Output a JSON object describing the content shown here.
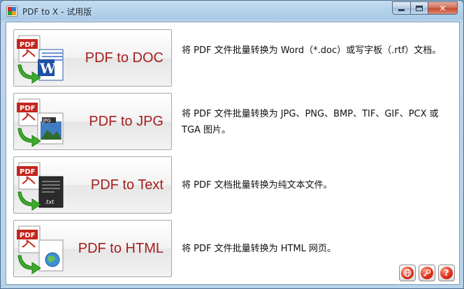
{
  "window": {
    "title": "PDF to X - 试用版"
  },
  "converters": [
    {
      "label": "PDF to DOC",
      "description": "将 PDF 文件批量转换为 Word（*.doc）或写字板（.rtf）文档。",
      "icon": "pdf-to-word-icon",
      "doc_badge_text": "PDF",
      "target_text": "W"
    },
    {
      "label": "PDF to JPG",
      "description": "将 PDF 文件批量转换为 JPG、PNG、BMP、TIF、GIF、PCX 或 TGA 图片。",
      "icon": "pdf-to-image-icon",
      "doc_badge_text": "PDF",
      "target_text": "JPG"
    },
    {
      "label": "PDF to Text",
      "description": "将 PDF 文档批量转换为纯文本文件。",
      "icon": "pdf-to-text-icon",
      "doc_badge_text": "PDF",
      "target_text": ".txt"
    },
    {
      "label": "PDF to HTML",
      "description": "将 PDF 文件批量转换为 HTML 网页。",
      "icon": "pdf-to-html-icon",
      "doc_badge_text": "PDF",
      "target_text": ""
    }
  ],
  "toolbar": {
    "web_icon": "globe-icon",
    "register_icon": "key-icon",
    "help_label": "?"
  },
  "colors": {
    "label_red": "#a51d1d",
    "pdf_red": "#c4261d",
    "arrow_green": "#3caa2a",
    "window_frame": "#b7d3ea"
  }
}
